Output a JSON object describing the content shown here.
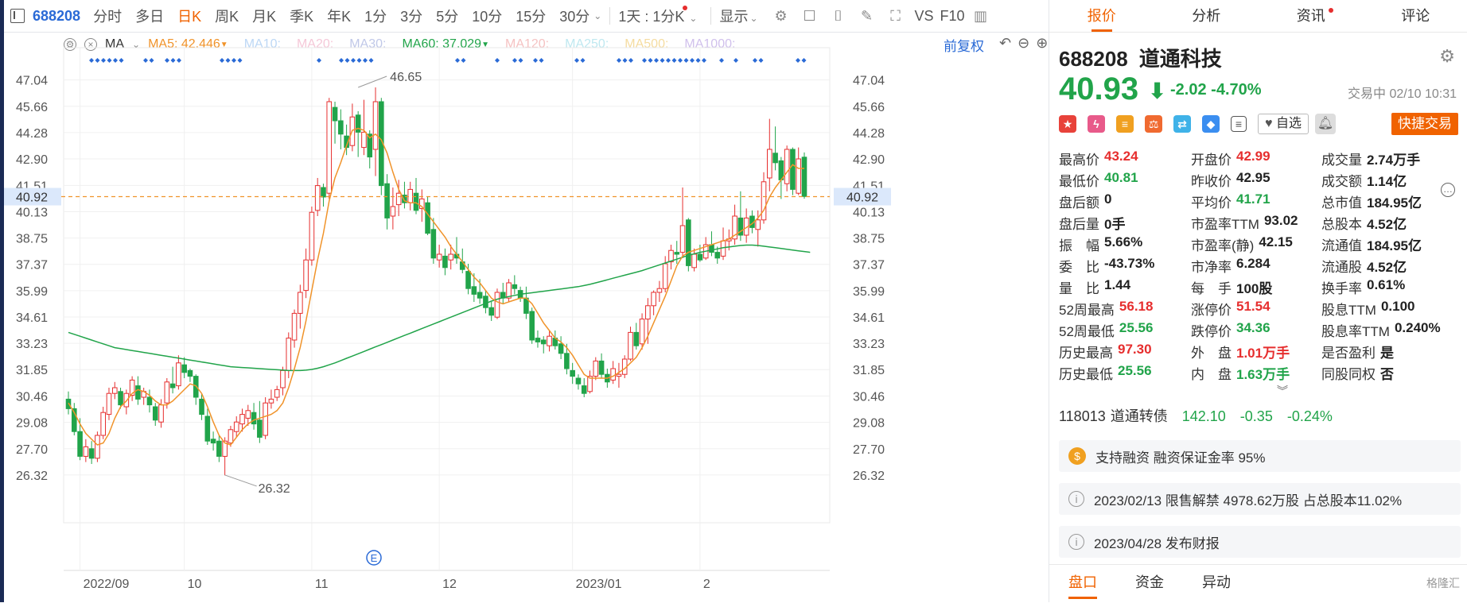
{
  "toolbar": {
    "code": "688208",
    "periods": [
      "分时",
      "多日",
      "日K",
      "周K",
      "月K",
      "季K",
      "年K",
      "1分",
      "3分",
      "5分",
      "10分",
      "15分",
      "30分"
    ],
    "active_period": "日K",
    "ktype": "1天 : 1分K",
    "display": "显示",
    "vs": "VS",
    "f10": "F10"
  },
  "ma": {
    "label": "MA",
    "ma5": "MA5: 42.446",
    "ma10": "MA10:",
    "ma20": "MA20:",
    "ma30": "MA30:",
    "ma60": "MA60: 37.029",
    "ma120": "MA120:",
    "ma250": "MA250:",
    "ma500": "MA500:",
    "ma1000": "MA1000:",
    "adjust": "前复权",
    "colors": {
      "ma5": "#f0932a",
      "ma60": "#21a44a",
      "faded": "#bcd7f5"
    }
  },
  "chart_data": {
    "type": "candlestick",
    "yticks": [
      "47.04",
      "45.66",
      "44.28",
      "42.90",
      "41.51",
      "40.13",
      "38.75",
      "37.37",
      "35.99",
      "34.61",
      "33.23",
      "31.85",
      "30.46",
      "29.08",
      "27.70",
      "26.32"
    ],
    "ylim": [
      25.4,
      47.9
    ],
    "xticks": [
      {
        "label": "2022/09",
        "i": 2
      },
      {
        "label": "10",
        "i": 20
      },
      {
        "label": "11",
        "i": 42
      },
      {
        "label": "12",
        "i": 64
      },
      {
        "label": "2023/01",
        "i": 87
      },
      {
        "label": "2",
        "i": 109
      }
    ],
    "current_price": "40.92",
    "high_mark": {
      "label": "46.65",
      "i": 50,
      "value": 46.65
    },
    "low_mark": {
      "label": "26.32",
      "i": 27,
      "value": 26.32
    },
    "event_marker": "E",
    "colors": {
      "up": "#e62e2e",
      "down": "#21a44a",
      "ma5": "#f0932a",
      "ma60": "#21a44a",
      "price_line": "#f0932a"
    },
    "candles": [
      [
        30.3,
        30.7,
        29.5,
        29.8
      ],
      [
        29.8,
        30.1,
        28.4,
        28.6
      ],
      [
        28.6,
        29.3,
        27.1,
        27.3
      ],
      [
        27.3,
        28.2,
        27.0,
        27.8
      ],
      [
        27.7,
        28.1,
        26.9,
        27.2
      ],
      [
        27.2,
        28.6,
        27.0,
        28.4
      ],
      [
        28.4,
        29.9,
        28.2,
        29.6
      ],
      [
        29.5,
        30.9,
        29.2,
        30.6
      ],
      [
        30.6,
        31.2,
        30.3,
        30.9
      ],
      [
        30.7,
        30.9,
        29.8,
        30.0
      ],
      [
        29.9,
        30.8,
        29.5,
        30.6
      ],
      [
        30.5,
        31.5,
        30.2,
        31.3
      ],
      [
        31.0,
        31.5,
        30.0,
        30.3
      ],
      [
        30.4,
        30.9,
        30.0,
        30.7
      ],
      [
        30.4,
        30.8,
        29.6,
        30.0
      ],
      [
        29.9,
        30.1,
        28.9,
        29.2
      ],
      [
        29.1,
        30.3,
        28.8,
        30.0
      ],
      [
        30.1,
        31.4,
        29.8,
        31.2
      ],
      [
        31.1,
        32.0,
        30.6,
        30.9
      ],
      [
        31.0,
        32.6,
        30.8,
        32.2
      ],
      [
        32.1,
        32.5,
        31.4,
        31.7
      ],
      [
        31.8,
        31.9,
        31.2,
        31.5
      ],
      [
        31.5,
        31.6,
        30.0,
        30.4
      ],
      [
        30.3,
        30.6,
        29.2,
        29.5
      ],
      [
        29.4,
        29.8,
        27.9,
        28.1
      ],
      [
        28.2,
        28.6,
        27.6,
        28.0
      ],
      [
        28.1,
        28.4,
        27.0,
        27.3
      ],
      [
        27.3,
        28.3,
        26.3,
        28.1
      ],
      [
        28.0,
        28.9,
        27.8,
        28.7
      ],
      [
        28.6,
        29.4,
        28.3,
        29.1
      ],
      [
        29.0,
        29.8,
        28.6,
        29.5
      ],
      [
        29.3,
        30.0,
        28.9,
        29.7
      ],
      [
        29.6,
        30.1,
        28.7,
        29.0
      ],
      [
        29.2,
        30.2,
        28.0,
        28.3
      ],
      [
        28.4,
        30.4,
        28.2,
        30.1
      ],
      [
        30.1,
        30.8,
        29.8,
        30.3
      ],
      [
        30.4,
        31.0,
        30.2,
        30.8
      ],
      [
        30.9,
        32.0,
        30.5,
        31.8
      ],
      [
        31.8,
        33.8,
        31.4,
        33.5
      ],
      [
        33.4,
        35.0,
        33.0,
        34.8
      ],
      [
        34.8,
        36.3,
        34.0,
        35.9
      ],
      [
        36.0,
        38.2,
        35.6,
        37.6
      ],
      [
        37.6,
        40.4,
        37.3,
        40.1
      ],
      [
        40.2,
        41.9,
        39.9,
        41.5
      ],
      [
        41.4,
        41.6,
        40.4,
        40.9
      ],
      [
        41.1,
        46.1,
        40.8,
        45.9
      ],
      [
        45.6,
        45.9,
        43.7,
        44.9
      ],
      [
        44.9,
        45.5,
        43.4,
        44.2
      ],
      [
        44.1,
        44.7,
        43.1,
        43.5
      ],
      [
        43.6,
        45.8,
        43.3,
        45.1
      ],
      [
        45.2,
        45.4,
        43.0,
        44.3
      ],
      [
        43.5,
        46.0,
        43.1,
        44.3
      ],
      [
        44.2,
        44.4,
        42.4,
        43.0
      ],
      [
        43.4,
        46.65,
        42.0,
        45.9
      ],
      [
        45.9,
        46.1,
        41.0,
        41.5
      ],
      [
        41.6,
        42.1,
        39.2,
        39.8
      ],
      [
        39.9,
        41.4,
        39.2,
        40.4
      ],
      [
        40.5,
        41.8,
        39.9,
        41.1
      ],
      [
        41.0,
        41.7,
        40.3,
        40.6
      ],
      [
        40.6,
        41.7,
        40.2,
        41.3
      ],
      [
        41.1,
        41.9,
        40.0,
        40.2
      ],
      [
        40.3,
        41.3,
        39.6,
        40.8
      ],
      [
        40.6,
        40.9,
        38.9,
        39.0
      ],
      [
        39.2,
        39.8,
        37.4,
        37.7
      ],
      [
        37.6,
        38.4,
        37.2,
        37.9
      ],
      [
        37.8,
        38.2,
        36.8,
        37.2
      ],
      [
        37.6,
        38.4,
        37.1,
        37.9
      ],
      [
        37.9,
        38.8,
        37.4,
        37.7
      ],
      [
        37.5,
        38.2,
        36.9,
        37.1
      ],
      [
        37.0,
        37.4,
        35.8,
        36.1
      ],
      [
        36.2,
        36.9,
        35.4,
        35.8
      ],
      [
        35.9,
        36.6,
        35.3,
        35.6
      ],
      [
        35.7,
        36.0,
        34.8,
        35.1
      ],
      [
        35.1,
        35.4,
        34.4,
        34.7
      ],
      [
        34.6,
        36.1,
        34.5,
        35.9
      ],
      [
        35.9,
        36.4,
        35.3,
        35.6
      ],
      [
        35.6,
        36.6,
        35.4,
        36.4
      ],
      [
        36.3,
        36.8,
        35.8,
        36.1
      ],
      [
        36.0,
        36.2,
        35.4,
        35.6
      ],
      [
        35.6,
        36.2,
        34.5,
        34.8
      ],
      [
        34.9,
        35.1,
        33.2,
        33.4
      ],
      [
        33.5,
        33.9,
        33.0,
        33.3
      ],
      [
        33.4,
        33.6,
        32.7,
        33.2
      ],
      [
        33.1,
        33.9,
        32.8,
        33.6
      ],
      [
        33.5,
        33.9,
        32.9,
        33.1
      ],
      [
        33.2,
        33.6,
        32.4,
        32.7
      ],
      [
        32.7,
        33.2,
        31.6,
        31.9
      ],
      [
        31.8,
        32.2,
        31.1,
        31.5
      ],
      [
        31.4,
        31.6,
        30.8,
        31.1
      ],
      [
        31.0,
        31.4,
        30.4,
        30.6
      ],
      [
        30.7,
        31.8,
        30.6,
        31.5
      ],
      [
        31.5,
        32.5,
        31.3,
        32.3
      ],
      [
        32.3,
        32.7,
        31.4,
        31.6
      ],
      [
        31.6,
        31.9,
        30.9,
        31.2
      ],
      [
        31.3,
        32.3,
        31.1,
        31.9
      ],
      [
        31.5,
        32.2,
        30.9,
        31.6
      ],
      [
        31.6,
        32.6,
        31.4,
        32.4
      ],
      [
        32.4,
        34.1,
        32.3,
        33.8
      ],
      [
        33.8,
        34.3,
        32.9,
        33.1
      ],
      [
        33.2,
        34.8,
        32.9,
        34.5
      ],
      [
        34.5,
        35.6,
        33.2,
        35.2
      ],
      [
        35.2,
        36.0,
        34.7,
        35.9
      ],
      [
        35.9,
        36.5,
        35.4,
        36.1
      ],
      [
        36.1,
        37.8,
        35.9,
        37.4
      ],
      [
        37.5,
        38.4,
        37.1,
        38.1
      ],
      [
        38.0,
        38.6,
        37.4,
        37.9
      ],
      [
        38.0,
        41.4,
        37.7,
        39.4
      ],
      [
        39.7,
        39.8,
        37.0,
        37.3
      ],
      [
        37.2,
        38.2,
        37.0,
        37.9
      ],
      [
        37.9,
        38.4,
        37.5,
        37.6
      ],
      [
        37.7,
        38.8,
        37.6,
        38.4
      ],
      [
        38.4,
        39.1,
        37.8,
        38.0
      ],
      [
        38.0,
        38.3,
        37.4,
        37.7
      ],
      [
        37.8,
        39.3,
        37.6,
        38.6
      ],
      [
        38.6,
        39.2,
        38.1,
        38.7
      ],
      [
        38.7,
        40.5,
        38.4,
        39.9
      ],
      [
        39.8,
        41.2,
        38.6,
        38.9
      ],
      [
        38.9,
        40.3,
        38.5,
        39.8
      ],
      [
        39.9,
        40.2,
        39.0,
        39.3
      ],
      [
        39.2,
        40.2,
        38.3,
        39.7
      ],
      [
        39.7,
        42.2,
        39.5,
        41.7
      ],
      [
        41.9,
        45.0,
        41.2,
        43.4
      ],
      [
        43.2,
        44.6,
        42.3,
        42.7
      ],
      [
        42.8,
        43.0,
        40.8,
        41.8
      ],
      [
        41.6,
        43.6,
        41.2,
        43.4
      ],
      [
        43.4,
        43.5,
        41.0,
        41.3
      ],
      [
        41.1,
        43.5,
        41.0,
        42.9
      ],
      [
        42.99,
        43.24,
        40.81,
        40.93
      ]
    ],
    "ma5": [
      30.1,
      29.6,
      29.0,
      28.5,
      28.2,
      27.9,
      28.0,
      28.5,
      29.3,
      29.9,
      30.2,
      30.6,
      30.8,
      30.7,
      30.5,
      30.2,
      30.0,
      30.0,
      30.2,
      30.5,
      30.8,
      31.1,
      31.0,
      30.6,
      29.9,
      29.1,
      28.4,
      28.0,
      27.9,
      28.3,
      28.7,
      29.0,
      29.2,
      29.3,
      29.4,
      29.5,
      29.7,
      30.1,
      30.9,
      31.9,
      33.0,
      34.4,
      36.0,
      37.6,
      39.0,
      40.7,
      41.9,
      42.7,
      43.6,
      44.4,
      44.5,
      44.4,
      44.0,
      44.2,
      43.9,
      43.2,
      42.2,
      41.3,
      40.7,
      40.6,
      40.6,
      40.4,
      40.0,
      39.6,
      39.2,
      38.8,
      38.3,
      37.9,
      37.5,
      37.1,
      36.7,
      36.4,
      36.0,
      35.6,
      35.4,
      35.3,
      35.4,
      35.5,
      35.6,
      35.6,
      35.3,
      34.8,
      34.3,
      33.9,
      33.5,
      33.3,
      33.0,
      32.6,
      32.1,
      31.6,
      31.4,
      31.4,
      31.4,
      31.4,
      31.5,
      31.7,
      31.9,
      32.2,
      32.5,
      33.0,
      33.6,
      34.3,
      35.0,
      35.7,
      36.5,
      37.3,
      37.8,
      38.0,
      38.1,
      38.2,
      38.3,
      38.4,
      38.5,
      38.6,
      38.7,
      38.9,
      39.1,
      39.3,
      39.5,
      39.8,
      40.2,
      40.9,
      41.4,
      41.8,
      42.2,
      42.6,
      42.4,
      42.4
    ],
    "ma60": [
      33.8,
      33.7,
      33.6,
      33.5,
      33.4,
      33.3,
      33.2,
      33.1,
      33.0,
      32.95,
      32.9,
      32.85,
      32.8,
      32.75,
      32.7,
      32.65,
      32.6,
      32.55,
      32.5,
      32.45,
      32.4,
      32.35,
      32.3,
      32.25,
      32.2,
      32.15,
      32.1,
      32.05,
      32.0,
      31.98,
      31.96,
      31.94,
      31.92,
      31.9,
      31.88,
      31.86,
      31.84,
      31.82,
      31.8,
      31.8,
      31.8,
      31.82,
      31.86,
      31.92,
      32.0,
      32.1,
      32.2,
      32.32,
      32.44,
      32.56,
      32.68,
      32.8,
      32.92,
      33.04,
      33.16,
      33.28,
      33.4,
      33.52,
      33.64,
      33.76,
      33.88,
      34.0,
      34.12,
      34.24,
      34.36,
      34.48,
      34.6,
      34.72,
      34.84,
      34.96,
      35.08,
      35.2,
      35.32,
      35.44,
      35.54,
      35.62,
      35.68,
      35.74,
      35.8,
      35.84,
      35.88,
      35.92,
      35.96,
      36.0,
      36.04,
      36.08,
      36.12,
      36.16,
      36.2,
      36.26,
      36.32,
      36.4,
      36.48,
      36.56,
      36.64,
      36.72,
      36.8,
      36.88,
      36.96,
      37.04,
      37.14,
      37.24,
      37.34,
      37.44,
      37.54,
      37.64,
      37.74,
      37.84,
      37.92,
      38.0,
      38.06,
      38.12,
      38.18,
      38.24,
      38.28,
      38.32,
      38.36,
      38.38,
      38.38,
      38.36,
      38.32,
      38.28,
      38.24,
      38.2,
      38.16,
      38.12,
      38.08,
      38.04,
      38.0
    ]
  },
  "panel": {
    "tabs": [
      "报价",
      "分析",
      "资讯",
      "评论"
    ],
    "active_tab": "报价",
    "code": "688208",
    "name": "道通科技",
    "price": "40.93",
    "arrow": "⬇",
    "change": "-2.02",
    "change_pct": "-4.70%",
    "status": "交易中 02/10 10:31",
    "zixuan": "自选",
    "quick_trade": "快捷交易",
    "stats": [
      [
        {
          "l": "最高价",
          "v": "43.24",
          "c": "red"
        },
        {
          "l": "开盘价",
          "v": "42.99",
          "c": "red"
        },
        {
          "l": "成交量",
          "v": "2.74万手",
          "c": "blk"
        }
      ],
      [
        {
          "l": "最低价",
          "v": "40.81",
          "c": "grn"
        },
        {
          "l": "昨收价",
          "v": "42.95",
          "c": "blk"
        },
        {
          "l": "成交额",
          "v": "1.14亿",
          "c": "blk"
        }
      ],
      [
        {
          "l": "盘后额",
          "v": "0",
          "c": "blk"
        },
        {
          "l": "平均价",
          "v": "41.71",
          "c": "grn"
        },
        {
          "l": "总市值",
          "v": "184.95亿",
          "c": "blk"
        }
      ],
      [
        {
          "l": "盘后量",
          "v": "0手",
          "c": "blk"
        },
        {
          "l": "市盈率TTM",
          "v": "93.02",
          "c": "blk"
        },
        {
          "l": "总股本",
          "v": "4.52亿",
          "c": "blk"
        }
      ],
      [
        {
          "l": "振　幅",
          "v": "5.66%",
          "c": "blk"
        },
        {
          "l": "市盈率(静)",
          "v": "42.15",
          "c": "blk"
        },
        {
          "l": "流通值",
          "v": "184.95亿",
          "c": "blk"
        }
      ],
      [
        {
          "l": "委　比",
          "v": "-43.73%",
          "c": "blk"
        },
        {
          "l": "市净率",
          "v": "6.284",
          "c": "blk"
        },
        {
          "l": "流通股",
          "v": "4.52亿",
          "c": "blk"
        }
      ],
      [
        {
          "l": "量　比",
          "v": "1.44",
          "c": "blk"
        },
        {
          "l": "每　手",
          "v": "100股",
          "c": "blk"
        },
        {
          "l": "换手率",
          "v": "0.61%",
          "c": "blk"
        }
      ],
      [
        {
          "l": "52周最高",
          "v": "56.18",
          "c": "red"
        },
        {
          "l": "涨停价",
          "v": "51.54",
          "c": "red"
        },
        {
          "l": "股息TTM",
          "v": "0.100",
          "c": "blk"
        }
      ],
      [
        {
          "l": "52周最低",
          "v": "25.56",
          "c": "grn"
        },
        {
          "l": "跌停价",
          "v": "34.36",
          "c": "grn"
        },
        {
          "l": "股息率TTM",
          "v": "0.240%",
          "c": "blk"
        }
      ],
      [
        {
          "l": "历史最高",
          "v": "97.30",
          "c": "red"
        },
        {
          "l": "外　盘",
          "v": "1.01万手",
          "c": "red"
        },
        {
          "l": "是否盈利",
          "v": "是",
          "c": "blk"
        }
      ],
      [
        {
          "l": "历史最低",
          "v": "25.56",
          "c": "grn"
        },
        {
          "l": "内　盘",
          "v": "1.63万手",
          "c": "grn"
        },
        {
          "l": "同股同权",
          "v": "否",
          "c": "blk"
        }
      ]
    ],
    "bond": {
      "code": "118013",
      "name": "道通转债",
      "price": "142.10",
      "change": "-0.35",
      "pct": "-0.24%"
    },
    "cards": [
      {
        "icon": "$",
        "text": "支持融资 融资保证金率 95%"
      },
      {
        "icon": "i",
        "text": "2023/02/13  限售解禁 4978.62万股 占总股本11.02%"
      },
      {
        "icon": "i",
        "text": "2023/04/28  发布财报"
      }
    ],
    "bottom_tabs": [
      "盘口",
      "资金",
      "异动"
    ],
    "watermark": "格隆汇"
  }
}
